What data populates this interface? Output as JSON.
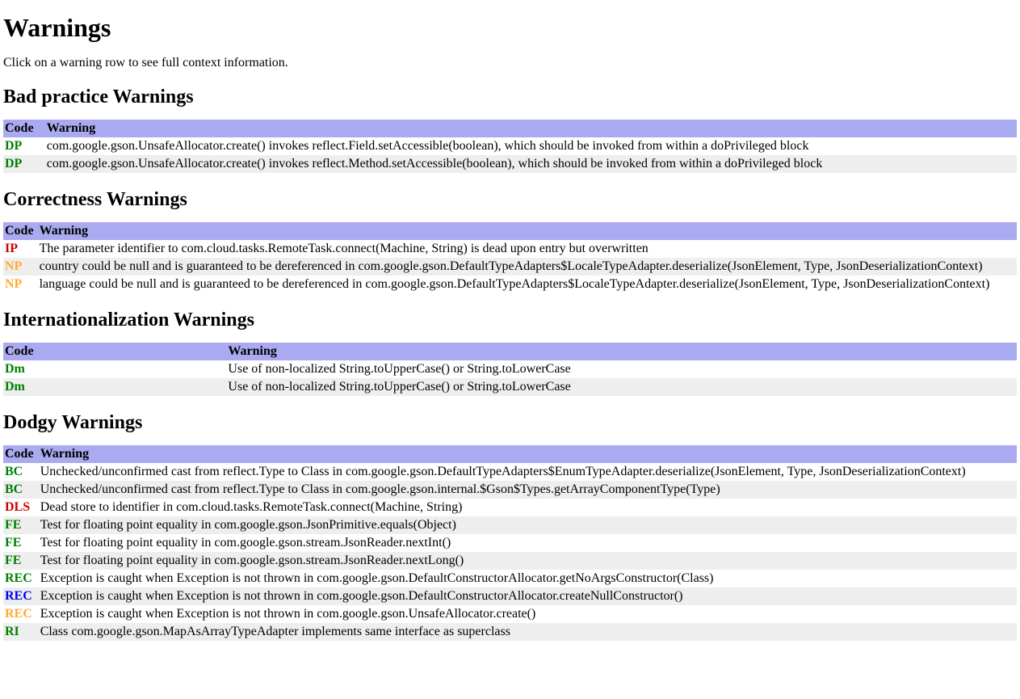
{
  "title": "Warnings",
  "intro": "Click on a warning row to see full context information.",
  "sections": [
    {
      "heading": "Bad practice Warnings",
      "cols": [
        "Code",
        "Warning"
      ],
      "rows": [
        {
          "code": "DP",
          "codeColor": "green",
          "text": "com.google.gson.UnsafeAllocator.create() invokes reflect.Field.setAccessible(boolean), which should be invoked from within a doPrivileged block"
        },
        {
          "code": "DP",
          "codeColor": "green",
          "text": "com.google.gson.UnsafeAllocator.create() invokes reflect.Method.setAccessible(boolean), which should be invoked from within a doPrivileged block"
        }
      ]
    },
    {
      "heading": "Correctness Warnings",
      "cols": [
        "Code",
        "Warning"
      ],
      "rows": [
        {
          "code": "IP",
          "codeColor": "red",
          "text": "The parameter identifier to com.cloud.tasks.RemoteTask.connect(Machine, String) is dead upon entry but overwritten"
        },
        {
          "code": "NP",
          "codeColor": "orange",
          "text": "country could be null and is guaranteed to be dereferenced in com.google.gson.DefaultTypeAdapters$LocaleTypeAdapter.deserialize(JsonElement, Type, JsonDeserializationContext)"
        },
        {
          "code": "NP",
          "codeColor": "orange",
          "text": "language could be null and is guaranteed to be dereferenced in com.google.gson.DefaultTypeAdapters$LocaleTypeAdapter.deserialize(JsonElement, Type, JsonDeserializationContext)"
        }
      ]
    },
    {
      "heading": "Internationalization Warnings",
      "cols": [
        "Code                    ",
        "Warning"
      ],
      "rows": [
        {
          "code": "Dm",
          "codeColor": "green",
          "text": "Use of non-localized String.toUpperCase() or String.toLowerCase"
        },
        {
          "code": "Dm",
          "codeColor": "green",
          "text": "Use of non-localized String.toUpperCase() or String.toLowerCase"
        }
      ]
    },
    {
      "heading": "Dodgy Warnings",
      "cols": [
        "Code",
        "Warning"
      ],
      "rows": [
        {
          "code": "BC",
          "codeColor": "green",
          "text": "Unchecked/unconfirmed cast from reflect.Type to Class in com.google.gson.DefaultTypeAdapters$EnumTypeAdapter.deserialize(JsonElement, Type, JsonDeserializationContext)"
        },
        {
          "code": "BC",
          "codeColor": "green",
          "text": "Unchecked/unconfirmed cast from reflect.Type to Class in com.google.gson.internal.$Gson$Types.getArrayComponentType(Type)"
        },
        {
          "code": "DLS",
          "codeColor": "red",
          "text": "Dead store to identifier in com.cloud.tasks.RemoteTask.connect(Machine, String)"
        },
        {
          "code": "FE",
          "codeColor": "green",
          "text": "Test for floating point equality in com.google.gson.JsonPrimitive.equals(Object)"
        },
        {
          "code": "FE",
          "codeColor": "green",
          "text": "Test for floating point equality in com.google.gson.stream.JsonReader.nextInt()"
        },
        {
          "code": "FE",
          "codeColor": "green",
          "text": "Test for floating point equality in com.google.gson.stream.JsonReader.nextLong()"
        },
        {
          "code": "REC",
          "codeColor": "green",
          "text": "Exception is caught when Exception is not thrown in com.google.gson.DefaultConstructorAllocator.getNoArgsConstructor(Class)"
        },
        {
          "code": "REC",
          "codeColor": "blue",
          "text": "Exception is caught when Exception is not thrown in com.google.gson.DefaultConstructorAllocator.createNullConstructor()"
        },
        {
          "code": "REC",
          "codeColor": "orange",
          "text": "Exception is caught when Exception is not thrown in com.google.gson.UnsafeAllocator.create()"
        },
        {
          "code": "RI",
          "codeColor": "green",
          "text": "Class com.google.gson.MapAsArrayTypeAdapter implements same interface as superclass"
        }
      ]
    }
  ]
}
